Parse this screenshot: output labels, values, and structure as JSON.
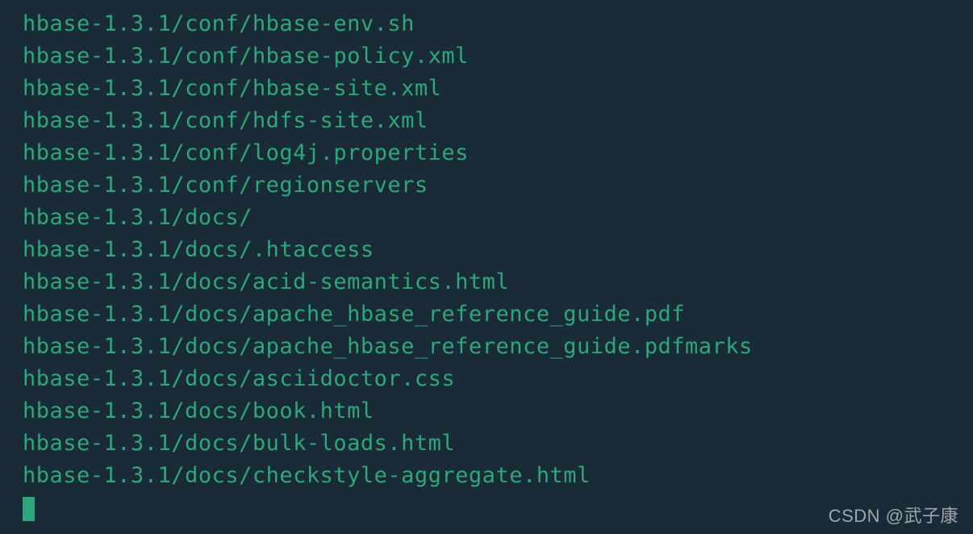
{
  "terminal": {
    "lines": [
      "hbase-1.3.1/conf/hbase-env.sh",
      "hbase-1.3.1/conf/hbase-policy.xml",
      "hbase-1.3.1/conf/hbase-site.xml",
      "hbase-1.3.1/conf/hdfs-site.xml",
      "hbase-1.3.1/conf/log4j.properties",
      "hbase-1.3.1/conf/regionservers",
      "hbase-1.3.1/docs/",
      "hbase-1.3.1/docs/.htaccess",
      "hbase-1.3.1/docs/acid-semantics.html",
      "hbase-1.3.1/docs/apache_hbase_reference_guide.pdf",
      "hbase-1.3.1/docs/apache_hbase_reference_guide.pdfmarks",
      "hbase-1.3.1/docs/asciidoctor.css",
      "hbase-1.3.1/docs/book.html",
      "hbase-1.3.1/docs/bulk-loads.html",
      "hbase-1.3.1/docs/checkstyle-aggregate.html"
    ]
  },
  "watermark": "CSDN @武子康"
}
